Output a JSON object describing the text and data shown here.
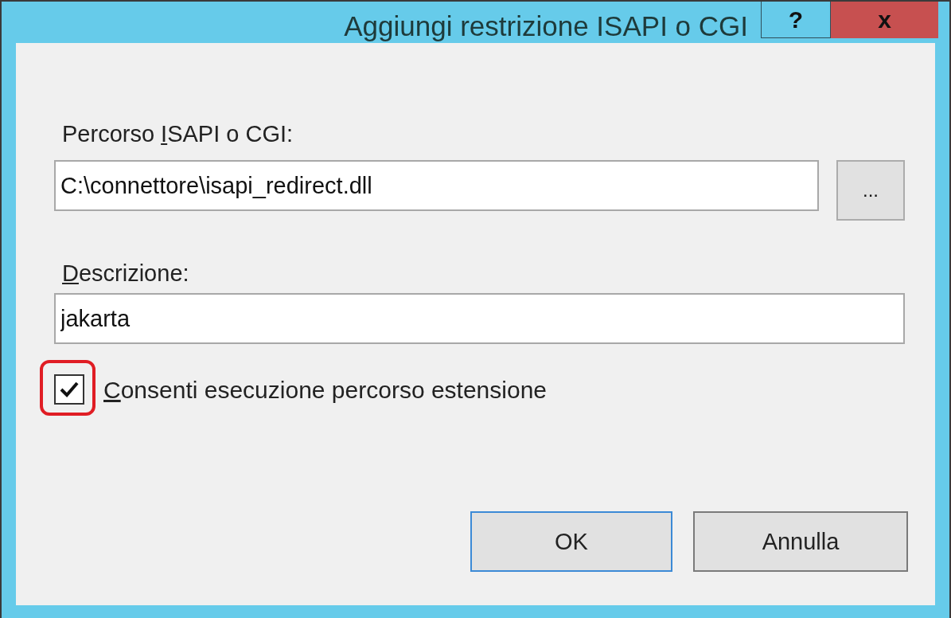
{
  "window": {
    "title": "Aggiungi restrizione ISAPI o CGI",
    "help_button": "?",
    "close_button": "x"
  },
  "path_field": {
    "label": {
      "before": "Percorso ",
      "access_key": "I",
      "after": "SAPI o CGI:"
    },
    "value": "C:\\connettore\\isapi_redirect.dll",
    "browse_button": "..."
  },
  "description_field": {
    "label": {
      "access_key": "D",
      "after": "escrizione:"
    },
    "value": "jakarta"
  },
  "checkbox": {
    "label": {
      "access_key": "C",
      "after": "onsenti esecuzione percorso estensione"
    },
    "checked": true,
    "highlighted": true
  },
  "buttons": [
    {
      "label": "OK",
      "selected": true
    },
    {
      "label": "Annulla",
      "selected": false
    }
  ]
}
